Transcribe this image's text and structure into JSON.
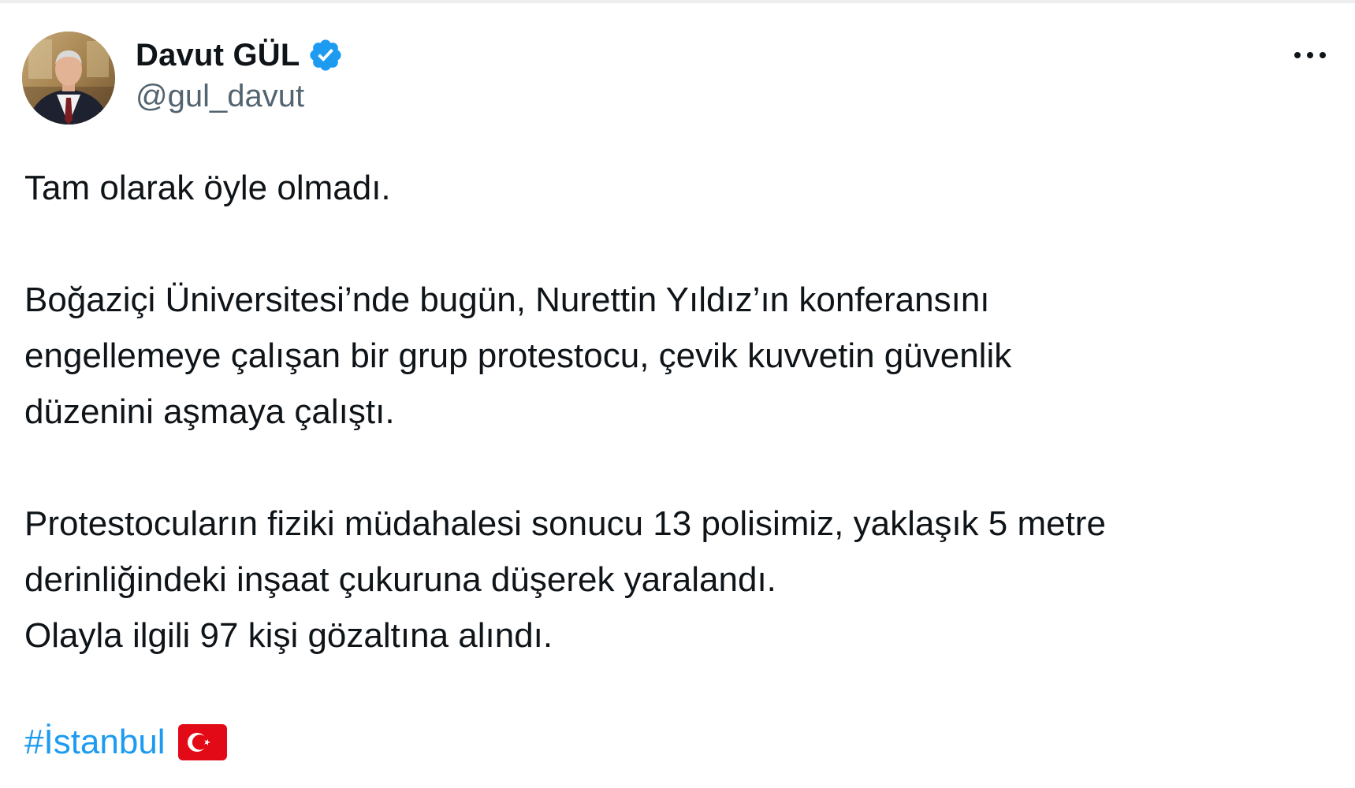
{
  "author": {
    "display_name": "Davut GÜL",
    "handle": "@gul_davut",
    "verified": true
  },
  "tweet": {
    "paragraphs": [
      [
        "Tam olarak öyle olmadı."
      ],
      [
        "Boğaziçi Üniversitesi’nde bugün, Nurettin Yıldız’ın konferansını",
        "engellemeye çalışan bir grup protestocu, çevik kuvvetin güvenlik",
        "düzenini aşmaya çalıştı."
      ],
      [
        "Protestocuların fiziki müdahalesi sonucu 13 polisimiz, yaklaşık 5 metre",
        "derinliğindeki inşaat çukuruna düşerek yaralandı.",
        "Olayla ilgili 97 kişi gözaltına alındı."
      ]
    ],
    "hashtag": "#İstanbul",
    "emoji": "turkey-flag"
  },
  "icons": {
    "verified": "verified-badge-icon",
    "more": "more-horizontal-icon",
    "flag": "turkey-flag-icon"
  },
  "colors": {
    "text": "#0f1419",
    "handle": "#536471",
    "link": "#1d9bf0",
    "verified": "#1d9bf0",
    "flag_red": "#e30a17"
  }
}
